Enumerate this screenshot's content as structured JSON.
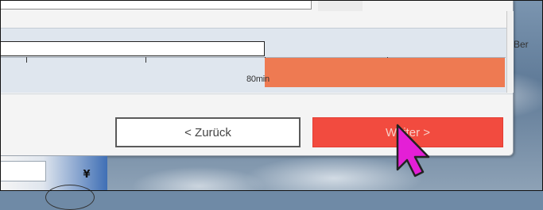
{
  "timeline": {
    "time_label": "80min",
    "side_label": "Ber"
  },
  "buttons": {
    "back_label": "< Zurück",
    "next_label": "Weiter >"
  },
  "combo": {
    "arrow_glyph": "¥"
  },
  "colors": {
    "fill_bar": "#ee7a52",
    "next_button": "#f24b3f",
    "cursor": "#e41fd6"
  },
  "icons": {
    "cursor": "mouse-pointer-icon"
  }
}
